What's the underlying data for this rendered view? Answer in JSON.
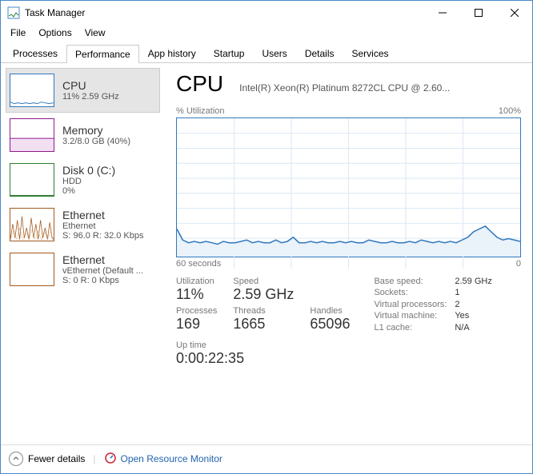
{
  "window": {
    "title": "Task Manager"
  },
  "menu": {
    "file": "File",
    "options": "Options",
    "view": "View"
  },
  "tabs": {
    "processes": "Processes",
    "performance": "Performance",
    "app_history": "App history",
    "startup": "Startup",
    "users": "Users",
    "details": "Details",
    "services": "Services"
  },
  "sidebar": {
    "cpu": {
      "title": "CPU",
      "sub": "11%  2.59 GHz"
    },
    "memory": {
      "title": "Memory",
      "sub": "3.2/8.0 GB (40%)"
    },
    "disk": {
      "title": "Disk 0 (C:)",
      "sub": "HDD",
      "sub2": "0%"
    },
    "eth0": {
      "title": "Ethernet",
      "sub": "Ethernet",
      "sub2": "S: 96.0  R: 32.0 Kbps"
    },
    "eth1": {
      "title": "Ethernet",
      "sub": "vEthernet (Default ...",
      "sub2": "S: 0  R: 0 Kbps"
    }
  },
  "main": {
    "title": "CPU",
    "subtitle": "Intel(R) Xeon(R) Platinum 8272CL CPU @ 2.60...",
    "chart_top_left": "% Utilization",
    "chart_top_right": "100%",
    "chart_bottom_left": "60 seconds",
    "chart_bottom_right": "0",
    "stats": {
      "utilization_label": "Utilization",
      "utilization_value": "11%",
      "speed_label": "Speed",
      "speed_value": "2.59 GHz",
      "processes_label": "Processes",
      "processes_value": "169",
      "threads_label": "Threads",
      "threads_value": "1665",
      "handles_label": "Handles",
      "handles_value": "65096",
      "uptime_label": "Up time",
      "uptime_value": "0:00:22:35",
      "base_speed_label": "Base speed:",
      "base_speed_value": "2.59 GHz",
      "sockets_label": "Sockets:",
      "sockets_value": "1",
      "vproc_label": "Virtual processors:",
      "vproc_value": "2",
      "vm_label": "Virtual machine:",
      "vm_value": "Yes",
      "l1_label": "L1 cache:",
      "l1_value": "N/A"
    }
  },
  "footer": {
    "fewer": "Fewer details",
    "resmon": "Open Resource Monitor"
  },
  "chart_data": {
    "type": "line",
    "title": "% Utilization",
    "xlabel": "60 seconds",
    "ylabel": "",
    "ylim": [
      0,
      100
    ],
    "x": [
      0,
      1,
      2,
      3,
      4,
      5,
      6,
      7,
      8,
      9,
      10,
      11,
      12,
      13,
      14,
      15,
      16,
      17,
      18,
      19,
      20,
      21,
      22,
      23,
      24,
      25,
      26,
      27,
      28,
      29,
      30,
      31,
      32,
      33,
      34,
      35,
      36,
      37,
      38,
      39,
      40,
      41,
      42,
      43,
      44,
      45,
      46,
      47,
      48,
      49,
      50,
      51,
      52,
      53,
      54,
      55,
      56,
      57,
      58,
      59
    ],
    "values": [
      20,
      12,
      10,
      11,
      10,
      11,
      10,
      9,
      11,
      10,
      10,
      11,
      12,
      10,
      11,
      10,
      10,
      12,
      10,
      11,
      14,
      10,
      10,
      11,
      10,
      11,
      10,
      10,
      11,
      10,
      11,
      10,
      10,
      12,
      11,
      10,
      10,
      11,
      10,
      10,
      11,
      10,
      12,
      11,
      10,
      11,
      10,
      11,
      10,
      12,
      14,
      18,
      20,
      22,
      18,
      14,
      12,
      13,
      12,
      11
    ]
  }
}
